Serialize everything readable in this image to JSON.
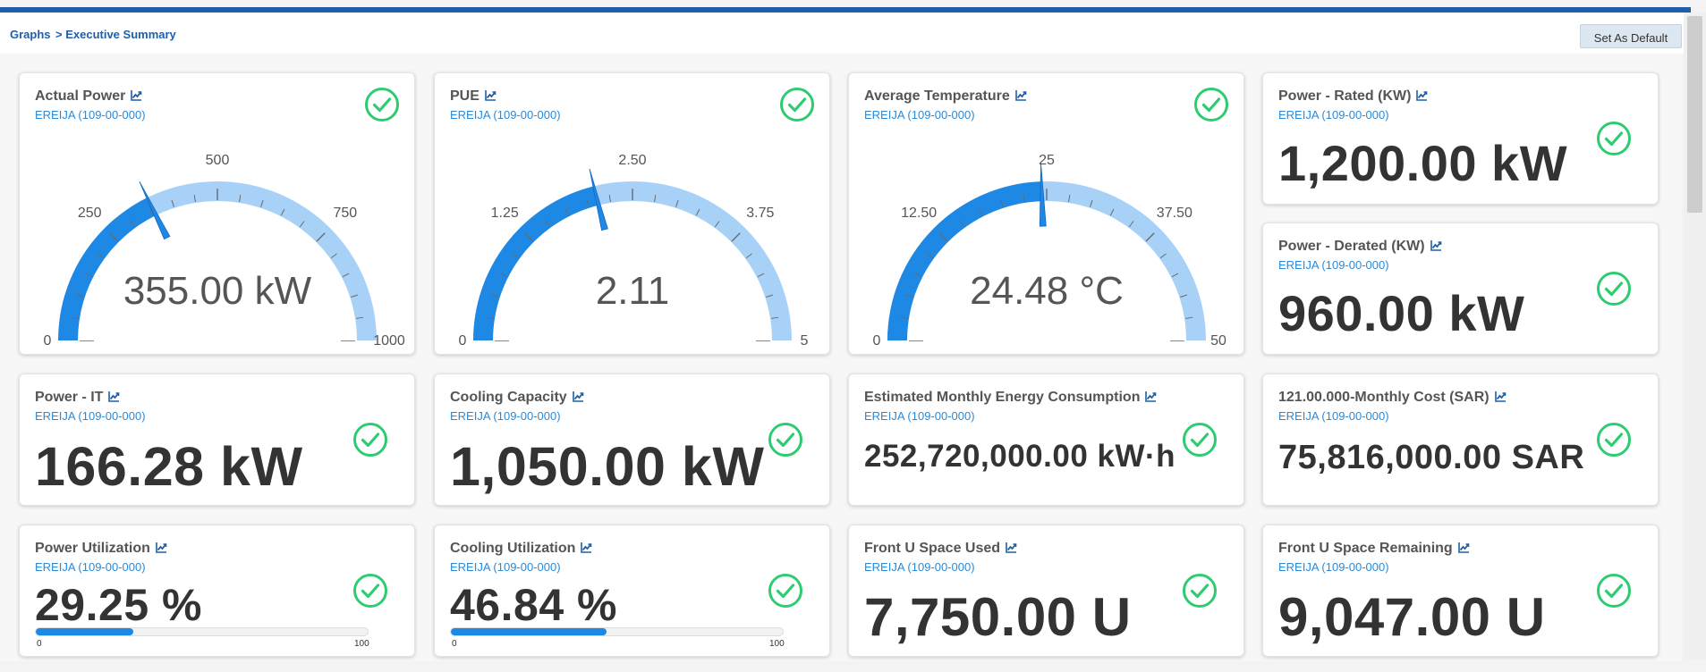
{
  "breadcrumb": {
    "root": "Graphs",
    "current": "> Executive Summary"
  },
  "toolbar": {
    "set_default_label": "Set As Default"
  },
  "colors": {
    "accent": "#1e88e5",
    "gauge_light": "#a7d1f7",
    "ok_green": "#2ecc71",
    "link": "#2a8ad8"
  },
  "icons": {
    "trend": "line-chart-icon",
    "status": "check-circle-icon"
  },
  "gauges": [
    {
      "title": "Actual Power",
      "location": "EREIJA (109-00-000)",
      "value": 355,
      "display": "355.00 kW",
      "min": 0,
      "max": 1000,
      "ticks": [
        "0",
        "250",
        "500",
        "750",
        "1000"
      ],
      "status": "ok"
    },
    {
      "title": "PUE",
      "location": "EREIJA (109-00-000)",
      "value": 2.11,
      "display": "2.11",
      "min": 0,
      "max": 5,
      "ticks": [
        "0",
        "1.25",
        "2.50",
        "3.75",
        "5"
      ],
      "status": "ok"
    },
    {
      "title": "Average Temperature",
      "location": "EREIJA (109-00-000)",
      "value": 24.48,
      "display": "24.48 °C",
      "min": 0,
      "max": 50,
      "ticks": [
        "0",
        "12.50",
        "25",
        "37.50",
        "50"
      ],
      "status": "ok"
    }
  ],
  "kpis": {
    "rated": {
      "title": "Power - Rated (KW)",
      "location": "EREIJA (109-00-000)",
      "value": "1,200.00 kW"
    },
    "derated": {
      "title": "Power - Derated (KW)",
      "location": "EREIJA (109-00-000)",
      "value": "960.00 kW"
    },
    "it": {
      "title": "Power - IT",
      "location": "EREIJA (109-00-000)",
      "value": "166.28 kW"
    },
    "cooling": {
      "title": "Cooling Capacity",
      "location": "EREIJA (109-00-000)",
      "value": "1,050.00 kW"
    },
    "energy": {
      "title": "Estimated Monthly Energy Consumption",
      "location": "EREIJA (109-00-000)",
      "value": "252,720,000.00 kW·h"
    },
    "cost": {
      "title": "121.00.000-Monthly Cost (SAR)",
      "location": "EREIJA (109-00-000)",
      "value": "75,816,000.00 SAR"
    },
    "front_used": {
      "title": "Front U Space Used",
      "location": "EREIJA (109-00-000)",
      "value": "7,750.00 U"
    },
    "front_remaining": {
      "title": "Front U Space Remaining",
      "location": "EREIJA (109-00-000)",
      "value": "9,047.00 U"
    }
  },
  "utilization": {
    "power": {
      "title": "Power Utilization",
      "location": "EREIJA (109-00-000)",
      "value": "29.25 %",
      "percent": 29.25,
      "min": "0",
      "max": "100"
    },
    "cooling": {
      "title": "Cooling Utilization",
      "location": "EREIJA (109-00-000)",
      "value": "46.84 %",
      "percent": 46.84,
      "min": "0",
      "max": "100"
    }
  }
}
